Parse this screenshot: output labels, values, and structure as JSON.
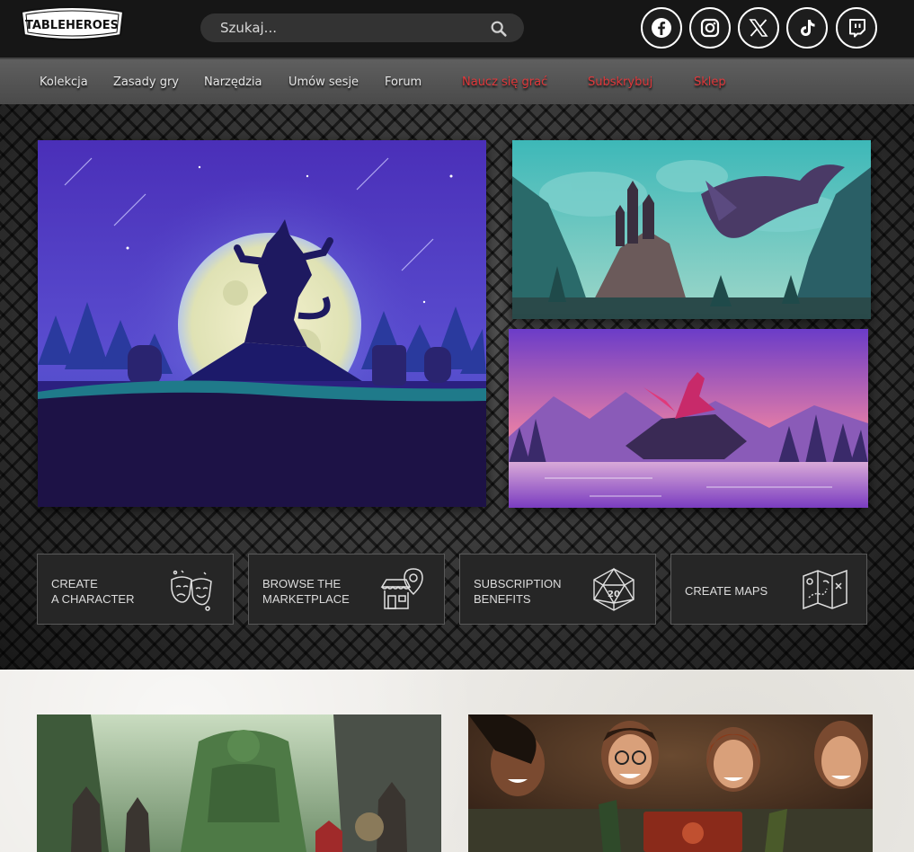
{
  "header": {
    "logo_text": "TABLEHEROES",
    "search": {
      "placeholder": "Szukaj...",
      "value": ""
    },
    "socials": [
      {
        "name": "facebook-icon"
      },
      {
        "name": "instagram-icon"
      },
      {
        "name": "x-icon"
      },
      {
        "name": "tiktok-icon"
      },
      {
        "name": "twitch-icon"
      }
    ]
  },
  "nav": {
    "items": [
      {
        "label": "Kolekcja",
        "accent": false
      },
      {
        "label": "Zasady gry",
        "accent": false
      },
      {
        "label": "Narzędzia",
        "accent": false
      },
      {
        "label": "Umów sesje",
        "accent": false
      },
      {
        "label": "Forum",
        "accent": false
      },
      {
        "label": "Naucz się grać",
        "accent": true
      },
      {
        "label": "Subskrybuj",
        "accent": true
      },
      {
        "label": "Sklep",
        "accent": true
      }
    ]
  },
  "hero": {
    "panels": [
      {
        "name": "werewolf-moon-illustration"
      },
      {
        "name": "dragon-castle-illustration"
      },
      {
        "name": "dragon-lake-illustration"
      }
    ]
  },
  "cta": [
    {
      "label": "Create a character",
      "line1": "Create",
      "line2": "A Character",
      "icon": "theater-masks-icon"
    },
    {
      "label": "Browse the marketplace",
      "line1": "Browse the",
      "line2": "Marketplace",
      "icon": "shop-location-icon"
    },
    {
      "label": "Subscription benefits",
      "line1": "Subscription",
      "line2": "Benefits",
      "icon": "d20-dice-icon"
    },
    {
      "label": "Create maps",
      "line1": "Create Maps",
      "line2": "",
      "icon": "treasure-map-icon"
    }
  ],
  "colors": {
    "accent": "#e0383b",
    "header_bg": "#161616",
    "nav_bg": "#555555"
  }
}
